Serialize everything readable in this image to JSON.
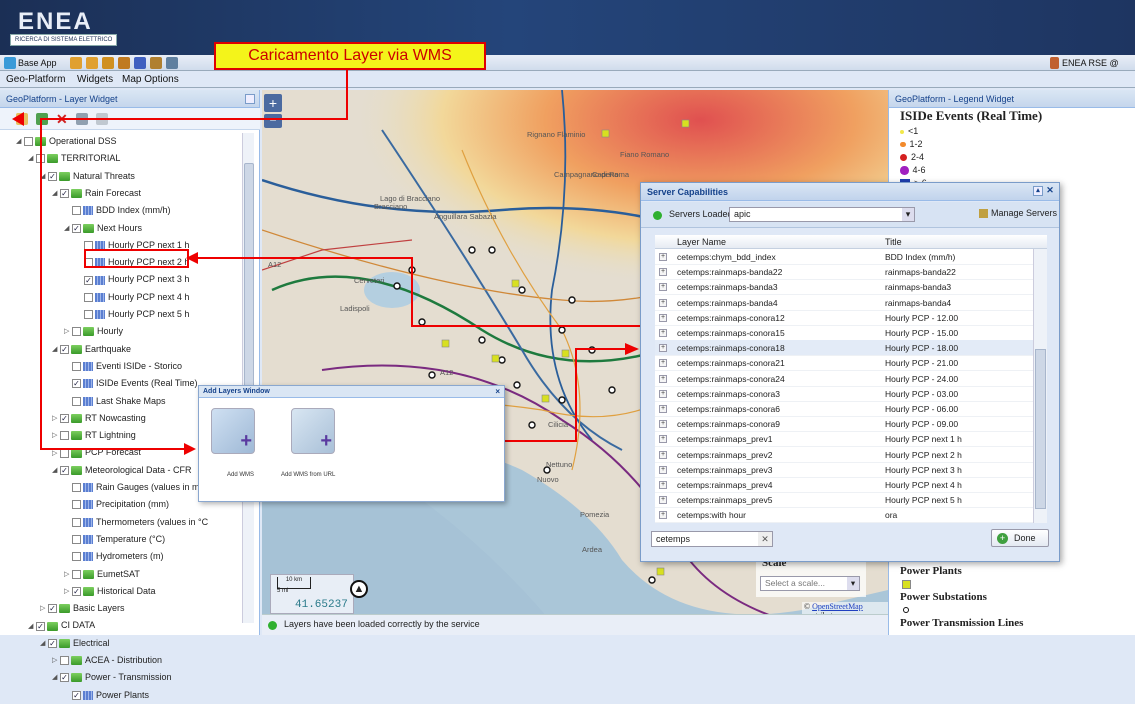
{
  "header": {
    "logo_text": "ENEA",
    "logo_subtitle": "RICERCA DI SISTEMA ELETTRICO"
  },
  "toolbar": {
    "base_app": "Base App",
    "user": "ENEA RSE @ geoSDI"
  },
  "menu": {
    "items": [
      "Geo-Platform",
      "Widgets",
      "Map Options"
    ]
  },
  "callout": {
    "text": "Caricamento Layer via WMS"
  },
  "left_panel": {
    "title": "GeoPlatform - Layer Widget"
  },
  "tree": [
    {
      "label": "Operational DSS",
      "indent": 0,
      "type": "folder",
      "checked": false,
      "expanded": true
    },
    {
      "label": "TERRITORIAL",
      "indent": 1,
      "type": "folder",
      "checked": false,
      "expanded": true
    },
    {
      "label": "Natural Threats",
      "indent": 2,
      "type": "folder",
      "checked": true,
      "expanded": true
    },
    {
      "label": "Rain Forecast",
      "indent": 3,
      "type": "folder",
      "checked": true,
      "expanded": true
    },
    {
      "label": "BDD Index (mm/h)",
      "indent": 4,
      "type": "layer",
      "checked": false
    },
    {
      "label": "Next Hours",
      "indent": 4,
      "type": "folder",
      "checked": true,
      "expanded": true
    },
    {
      "label": "Hourly PCP next 1 h",
      "indent": 5,
      "type": "layer",
      "checked": false
    },
    {
      "label": "Hourly PCP next 2 h",
      "indent": 5,
      "type": "layer",
      "checked": false
    },
    {
      "label": "Hourly PCP next 3 h",
      "indent": 5,
      "type": "layer",
      "checked": true
    },
    {
      "label": "Hourly PCP next 4 h",
      "indent": 5,
      "type": "layer",
      "checked": false
    },
    {
      "label": "Hourly PCP next 5 h",
      "indent": 5,
      "type": "layer",
      "checked": false
    },
    {
      "label": "Hourly",
      "indent": 4,
      "type": "folder",
      "checked": false,
      "expanded": false
    },
    {
      "label": "Earthquake",
      "indent": 3,
      "type": "folder",
      "checked": true,
      "expanded": true
    },
    {
      "label": "Eventi ISIDe - Storico",
      "indent": 4,
      "type": "layer",
      "checked": false
    },
    {
      "label": "ISIDe Events (Real Time)",
      "indent": 4,
      "type": "layer",
      "checked": true
    },
    {
      "label": "Last Shake Maps",
      "indent": 4,
      "type": "layer",
      "checked": false
    },
    {
      "label": "RT Nowcasting",
      "indent": 3,
      "type": "folder",
      "checked": true,
      "expanded": false
    },
    {
      "label": "RT Lightning",
      "indent": 3,
      "type": "folder",
      "checked": false,
      "expanded": false
    },
    {
      "label": "PCP Forecast",
      "indent": 3,
      "type": "folder",
      "checked": false,
      "expanded": false
    },
    {
      "label": "Meteorological Data - CFR",
      "indent": 3,
      "type": "folder",
      "checked": true,
      "expanded": true
    },
    {
      "label": "Rain Gauges (values in mm",
      "indent": 4,
      "type": "layer",
      "checked": false
    },
    {
      "label": "Precipitation (mm)",
      "indent": 4,
      "type": "layer",
      "checked": false
    },
    {
      "label": "Thermometers (values in °C",
      "indent": 4,
      "type": "layer",
      "checked": false
    },
    {
      "label": "Temperature (°C)",
      "indent": 4,
      "type": "layer",
      "checked": false
    },
    {
      "label": "Hydrometers (m)",
      "indent": 4,
      "type": "layer",
      "checked": false
    },
    {
      "label": "EumetSAT",
      "indent": 4,
      "type": "folder",
      "checked": false,
      "expanded": false
    },
    {
      "label": "Historical Data",
      "indent": 4,
      "type": "folder",
      "checked": true,
      "expanded": false
    },
    {
      "label": "Basic Layers",
      "indent": 2,
      "type": "folder",
      "checked": true,
      "expanded": false
    },
    {
      "label": "CI DATA",
      "indent": 1,
      "type": "folder",
      "checked": true,
      "expanded": true
    },
    {
      "label": "Electrical",
      "indent": 2,
      "type": "folder",
      "checked": true,
      "expanded": true
    },
    {
      "label": "ACEA - Distribution",
      "indent": 3,
      "type": "folder",
      "checked": false,
      "expanded": false
    },
    {
      "label": "Power - Transmission",
      "indent": 3,
      "type": "folder",
      "checked": true,
      "expanded": true
    },
    {
      "label": "Power Plants",
      "indent": 4,
      "type": "layer",
      "checked": true
    }
  ],
  "map": {
    "place_labels": [
      "Rignano Flaminio",
      "Fiano Romano",
      "Campagnano di Roma",
      "Bracciano",
      "Anguillara Sabazia",
      "Cerveteri",
      "Ladispoli",
      "Ardea",
      "Nettuno",
      "Capena",
      "A12",
      "A12",
      "Lago di Bracciano",
      "Cilicia",
      "Pomezia",
      "Nuovo"
    ],
    "scale_km": "10 km",
    "scale_mi": "5 mi",
    "coordinate": "41.65237",
    "scale_label": "Scale",
    "scale_placeholder": "Select a scale...",
    "attribution_prefix": "©",
    "attribution_link": "OpenStreetMap",
    "attribution_suffix": "contributors"
  },
  "status": {
    "message": "Layers have been loaded correctly by the service"
  },
  "legend": {
    "title": "GeoPlatform - Legend Widget",
    "heading": "ISIDe Events (Real Time)",
    "items": [
      {
        "label": "<1",
        "color": "#f2e84a"
      },
      {
        "label": "1-2",
        "color": "#f28a2c"
      },
      {
        "label": "2-4",
        "color": "#d42020"
      },
      {
        "label": "4-6",
        "color": "#a020c0"
      },
      {
        "label": "> 6",
        "color": "#2040b0"
      }
    ],
    "bottom": [
      {
        "label": "Power Plants",
        "color": "#d8e020"
      },
      {
        "label": "Power Substations",
        "color": "#000000"
      },
      {
        "label": "Power Transmission Lines",
        "color": "#000000"
      }
    ]
  },
  "dialog": {
    "title": "Server Capabilities",
    "servers_loaded_label": "Servers Loaded",
    "server_value": "apic",
    "manage_label": "Manage Servers",
    "col_name": "Layer Name",
    "col_title": "Title",
    "rows": [
      {
        "name": "cetemps:chym_bdd_index",
        "title": "BDD Index (mm/h)"
      },
      {
        "name": "cetemps:rainmaps-banda22",
        "title": "rainmaps-banda22"
      },
      {
        "name": "cetemps:rainmaps-banda3",
        "title": "rainmaps-banda3"
      },
      {
        "name": "cetemps:rainmaps-banda4",
        "title": "rainmaps-banda4"
      },
      {
        "name": "cetemps:rainmaps-conora12",
        "title": "Hourly PCP - 12.00"
      },
      {
        "name": "cetemps:rainmaps-conora15",
        "title": "Hourly PCP - 15.00"
      },
      {
        "name": "cetemps:rainmaps-conora18",
        "title": "Hourly PCP - 18.00"
      },
      {
        "name": "cetemps:rainmaps-conora21",
        "title": "Hourly PCP - 21.00"
      },
      {
        "name": "cetemps:rainmaps-conora24",
        "title": "Hourly PCP - 24.00"
      },
      {
        "name": "cetemps:rainmaps-conora3",
        "title": "Hourly PCP - 03.00"
      },
      {
        "name": "cetemps:rainmaps-conora6",
        "title": "Hourly PCP - 06.00"
      },
      {
        "name": "cetemps:rainmaps-conora9",
        "title": "Hourly PCP - 09.00"
      },
      {
        "name": "cetemps:rainmaps_prev1",
        "title": "Hourly PCP next 1 h"
      },
      {
        "name": "cetemps:rainmaps_prev2",
        "title": "Hourly PCP next 2 h"
      },
      {
        "name": "cetemps:rainmaps_prev3",
        "title": "Hourly PCP next 3 h"
      },
      {
        "name": "cetemps:rainmaps_prev4",
        "title": "Hourly PCP next 4 h"
      },
      {
        "name": "cetemps:rainmaps_prev5",
        "title": "Hourly PCP next 5 h"
      },
      {
        "name": "cetemps:with hour",
        "title": "ora"
      }
    ],
    "search_value": "cetemps",
    "done_label": "Done"
  },
  "addwin": {
    "title": "Add Layers Window",
    "wms_label": "Add WMS",
    "wms_url_label": "Add WMS from URL"
  }
}
